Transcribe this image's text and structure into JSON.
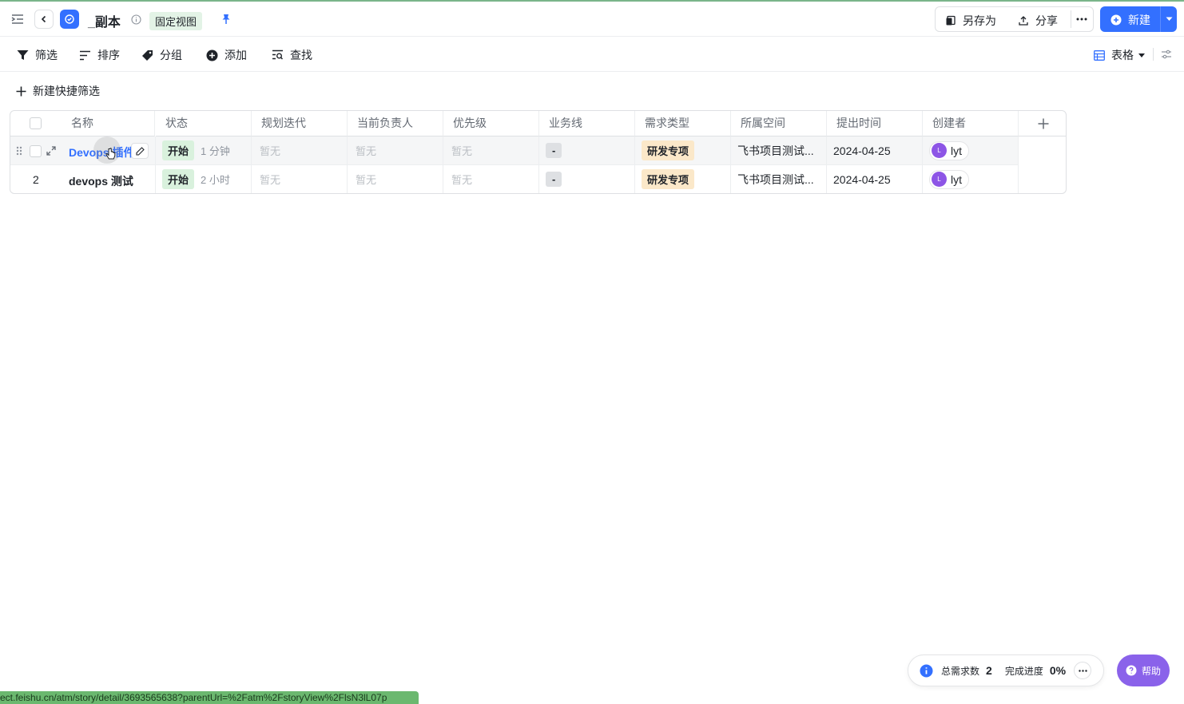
{
  "header": {
    "title": "_副本",
    "view_tag": "固定视图",
    "save_as_label": "另存为",
    "share_label": "分享",
    "new_label": "新建"
  },
  "toolbar": {
    "filter_label": "筛选",
    "sort_label": "排序",
    "group_label": "分组",
    "add_label": "添加",
    "find_label": "查找",
    "view_mode_label": "表格"
  },
  "quick_filter": {
    "label": "新建快捷筛选"
  },
  "table": {
    "columns": [
      "名称",
      "状态",
      "规划迭代",
      "当前负责人",
      "优先级",
      "业务线",
      "需求类型",
      "所属空间",
      "提出时间",
      "创建者"
    ],
    "rows": [
      {
        "index": "",
        "name": "Devops 插件",
        "status": "开始",
        "status_time": "1 分钟",
        "iteration": "暂无",
        "owner": "暂无",
        "priority": "暂无",
        "business_line": "-",
        "type": "研发专项",
        "space": "飞书项目测试...",
        "created": "2024-04-25",
        "creator_initial": "L",
        "creator": "lyt"
      },
      {
        "index": "2",
        "name": "devops 测试",
        "status": "开始",
        "status_time": "2 小时",
        "iteration": "暂无",
        "owner": "暂无",
        "priority": "暂无",
        "business_line": "-",
        "type": "研发专项",
        "space": "飞书项目测试...",
        "created": "2024-04-25",
        "creator_initial": "L",
        "creator": "lyt"
      }
    ]
  },
  "footer": {
    "total_label": "总需求数",
    "total_value": "2",
    "progress_label": "完成进度",
    "progress_value": "0%",
    "help_label": "帮助"
  },
  "statusbar": {
    "url": "ect.feishu.cn/atm/story/detail/3693565638?parentUrl=%2Fatm%2FstoryView%2FlsN3lL07p"
  },
  "colors": {
    "accent": "#3370ff",
    "help": "#8a62ea",
    "status_green": "#d9f1dd",
    "type_orange": "#fbe8c9"
  }
}
